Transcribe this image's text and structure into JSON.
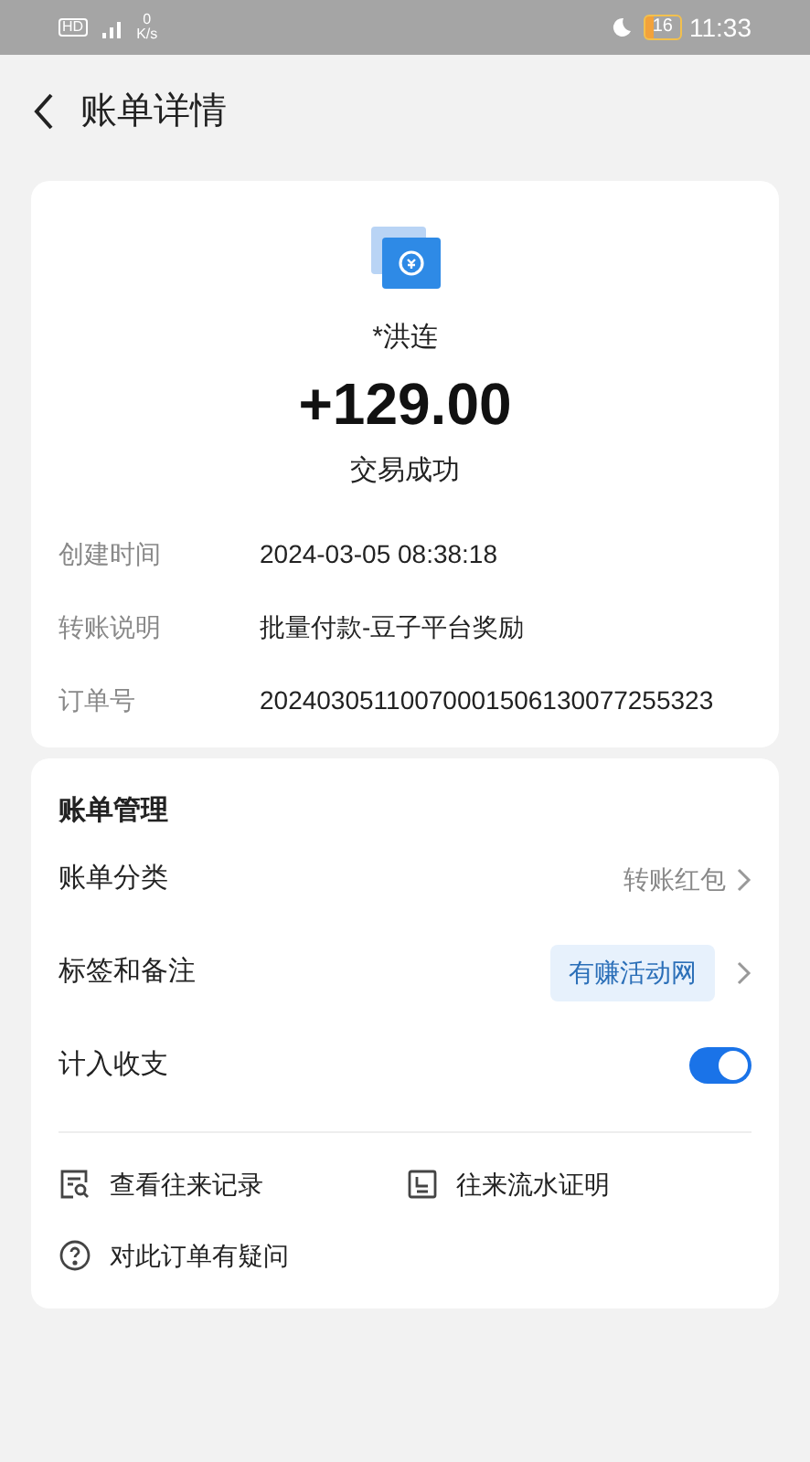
{
  "status_bar": {
    "hd": "HD",
    "speed_value": "0",
    "speed_unit": "K/s",
    "battery": "16",
    "time": "11:33"
  },
  "header": {
    "title": "账单详情"
  },
  "summary": {
    "name": "*洪连",
    "amount": "+129.00",
    "status": "交易成功",
    "details": [
      {
        "label": "创建时间",
        "value": "2024-03-05 08:38:18"
      },
      {
        "label": "转账说明",
        "value": "批量付款-豆子平台奖励"
      },
      {
        "label": "订单号",
        "value": "20240305110070001506130077255323"
      }
    ]
  },
  "management": {
    "title": "账单管理",
    "rows": [
      {
        "kind": "link",
        "label": "账单分类",
        "value": "转账红包"
      },
      {
        "kind": "tag",
        "label": "标签和备注",
        "value": "有赚活动网"
      },
      {
        "kind": "switch",
        "label": "计入收支",
        "on": true
      }
    ],
    "links": [
      {
        "kind": "records",
        "label": "查看往来记录"
      },
      {
        "kind": "proof",
        "label": "往来流水证明"
      },
      {
        "kind": "question",
        "label": "对此订单有疑问"
      }
    ]
  }
}
